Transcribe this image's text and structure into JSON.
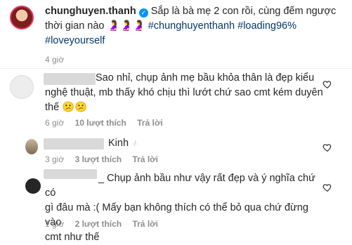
{
  "post": {
    "username": "chunghuyen.thanh",
    "caption_line1": "Sắp là bà mẹ 2 con rồi, cùng đếm ngược",
    "caption_line2_text": "thời gian nào",
    "caption_emojis": "🤰🤰🤰",
    "hashtag1": "#chunghuyenthanh",
    "hashtag2": "#loading96%",
    "hashtag3": "#loveyourself",
    "time": "4 giờ"
  },
  "comments": [
    {
      "line1": "Sao nhỉ, chụp ảnh mẹ bầu khỏa thân là đẹp kiểu",
      "line2": "nghệ thuật, mb thấy khó chịu thì lướt chứ sao cmt kém duyên",
      "line3": "thế",
      "emoji": "😕😕",
      "time": "6 giờ",
      "likes": "10 lượt thích",
      "reply": "Trả lời"
    },
    {
      "line1": "Kinh",
      "time": "3 giờ",
      "likes": "3 lượt thích",
      "reply": "Trả lời"
    },
    {
      "line1": "_ Chụp ảnh bầu như vậy rất đẹp và ý nghĩa chứ có",
      "line2": "gì đâu mà :( Mấy bạn không thích có thể bỏ qua chứ đừng vào",
      "line3": "cmt như thế",
      "time": "1 giờ",
      "likes": "2 lượt thích",
      "reply": "Trả lời"
    }
  ],
  "colors": {
    "verified": "#0095f6",
    "hashtag": "#00376b",
    "meta": "#8e8e8e"
  }
}
